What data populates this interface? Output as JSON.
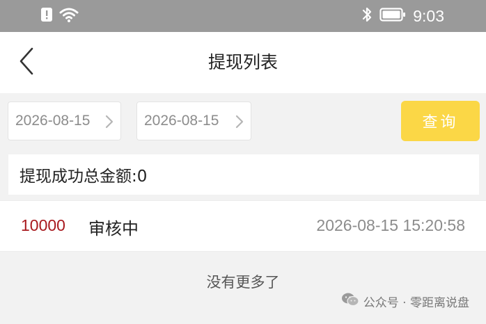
{
  "status_bar": {
    "time": "9:03",
    "icons": [
      "alert-icon",
      "wifi-icon",
      "bluetooth-icon",
      "battery-icon"
    ]
  },
  "nav": {
    "title": "提现列表",
    "back_icon": "chevron-left-icon"
  },
  "filters": {
    "start_date": "2026-08-15",
    "end_date": "2026-08-15",
    "search_label": "查询"
  },
  "summary": {
    "text": "提现成功总金额:0"
  },
  "records": [
    {
      "amount": "10000",
      "status": "审核中",
      "time": "2026-08-15 15:20:58"
    }
  ],
  "footer": {
    "no_more": "没有更多了"
  },
  "watermark": {
    "text": "公众号 · 零距离说盘"
  },
  "colors": {
    "accent": "#fbd746",
    "amount": "#a8191e",
    "status_bar": "#9a9a9a"
  }
}
